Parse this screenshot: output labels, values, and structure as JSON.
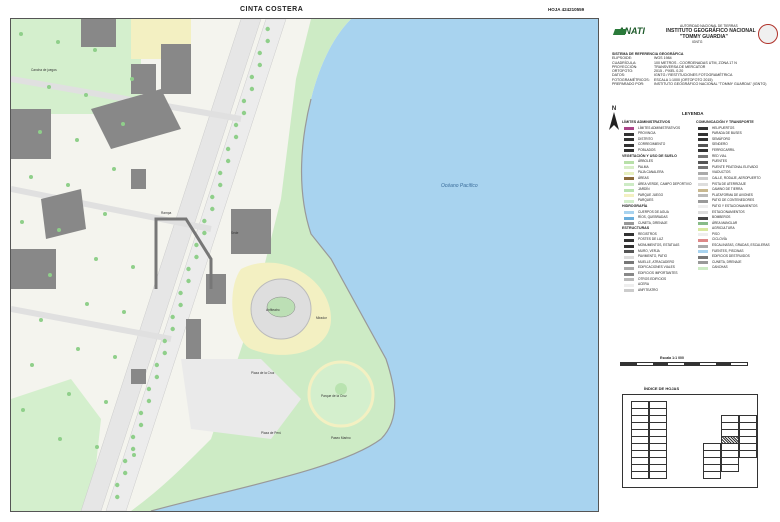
{
  "map": {
    "title": "CINTA COSTERA",
    "sheet_code": "HOJA 424210559",
    "sea_label": "Océano Pacífico",
    "place_labels": [
      "Cancha de juegos",
      "Sede",
      "Anfiteatro",
      "Plaza de la Cruz",
      "Parque de la Cruz",
      "Mirador",
      "Rampa",
      "Plaza de Perú",
      "Paseo Marino"
    ],
    "colors": {
      "sea": "#a8d3ef",
      "park": "#cdebc5",
      "sand": "#f3f0c2",
      "building": "#888888",
      "road": "#e6e6e6",
      "tree": "#8fcf8a"
    }
  },
  "panel": {
    "authority": "AUTORIDAD NACIONAL DE TIERRAS",
    "logo": "ANATI",
    "institute_1": "INSTITUTO GEOGRÁFICO NACIONAL",
    "institute_2": "\"TOMMY GUARDIA\"",
    "acronym": "IGNTG",
    "reference_header": "SISTEMA DE REFERENCIA GEOGRÁFICA",
    "reference_rows": [
      [
        "ELIPSOIDE:",
        "WGS 1984"
      ],
      [
        "CUADRÍCULA:",
        "100 METROS - COORDENADAS UTM, ZONA 17 N"
      ],
      [
        "PROYECCIÓN:",
        "TRANSVERSA DE MERCATOR"
      ],
      [
        "ORTOFOTO:",
        "2015 - PIXEL 0.20"
      ],
      [
        "DATOS:",
        "IGNTG / RESTITUCIONES FOTOGRAMÉTRICA"
      ],
      [
        "FOTOGRAMÉTRICOS:",
        "ESCALA 1:1000 (ORTOFOTO 2015)"
      ],
      [
        "PREPARADO POR:",
        "INSTITUTO GEOGRÁFICO NACIONAL \"TOMMY GUARDIA\" (IGNTG)"
      ]
    ],
    "north": "N",
    "legend_title": "LEYENDA",
    "legend_left": [
      {
        "header": "LÍMITES ADMINISTRATIVOS"
      },
      {
        "label": "LÍMITES ADMINISTRATIVOS",
        "color": "#aa4488"
      },
      {
        "label": "PROVINCIA",
        "color": "#333333"
      },
      {
        "label": "DISTRITO",
        "color": "#333333"
      },
      {
        "label": "CORREGIMIENTO",
        "color": "#333333"
      },
      {
        "label": "POBLADOS",
        "color": "#333333"
      },
      {
        "header": "VEGETACIÓN Y USO DE SUELO"
      },
      {
        "label": "ÁRBOLES",
        "color": "#b8e0a8"
      },
      {
        "label": "PALMA",
        "color": "#d8eec8"
      },
      {
        "label": "PAJA CANALERA",
        "color": "#e8f0c0"
      },
      {
        "label": "ÁREAS",
        "color": "#8a6a3a"
      },
      {
        "label": "ÁREA VERDE, CAMPO DEPORTIVO",
        "color": "#cdebc5"
      },
      {
        "label": "JARDÍN",
        "color": "#b9e3b0"
      },
      {
        "label": "PARQUE JUEGO",
        "color": "#f3f0c2"
      },
      {
        "label": "PARQUES",
        "color": "#d4efcd"
      },
      {
        "header": "HIDROGRAFÍA"
      },
      {
        "label": "CUERPOS DE AGUA",
        "color": "#a8d3ef"
      },
      {
        "label": "RÍOS, QUEBRADAS",
        "color": "#6aaedc"
      },
      {
        "label": "CUNETA, DRENAJE",
        "color": "#999999"
      },
      {
        "header": "ESTRUCTURAS"
      },
      {
        "label": "REGISTROS",
        "color": "#333333"
      },
      {
        "label": "POSTES DE LUZ",
        "color": "#333333"
      },
      {
        "label": "MONUMENTOS, ESTATUAS",
        "color": "#333333"
      },
      {
        "label": "MURO, VERJA",
        "color": "#555555"
      },
      {
        "label": "PAVIMENTO, PATIO",
        "color": "#dddddd"
      },
      {
        "label": "MUELLE, ATRACADERO",
        "color": "#777777"
      },
      {
        "label": "EDIFICACIONES VIALES",
        "color": "#aaaaaa"
      },
      {
        "label": "EDIFICIOS IMPORTANTES",
        "color": "#888888"
      },
      {
        "label": "OTROS EDIFICIOS",
        "color": "#bbbbbb"
      },
      {
        "label": "ACERA",
        "color": "#eeeeee"
      },
      {
        "label": "ANFITEATRO",
        "color": "#cccccc"
      }
    ],
    "legend_right": [
      {
        "header": "COMUNICACIÓN Y TRANSPORTE"
      },
      {
        "label": "HELIPUERTOS",
        "color": "#333333"
      },
      {
        "label": "PARADA DE BUSES",
        "color": "#333333"
      },
      {
        "label": "SEMÁFORO",
        "color": "#333333"
      },
      {
        "label": "SENDERO",
        "color": "#555555"
      },
      {
        "label": "FERROCARRIL",
        "color": "#333333"
      },
      {
        "label": "RED VIAL",
        "color": "#777777"
      },
      {
        "label": "PUENTES",
        "color": "#555555"
      },
      {
        "label": "PUENTE PEATONAL ELEVADO",
        "color": "#777777"
      },
      {
        "label": "VIADUCTOS",
        "color": "#aaaaaa"
      },
      {
        "label": "CALLE, RODAJE, AEROPUERTO",
        "color": "#cccccc"
      },
      {
        "label": "PISTA DE ATERRIZAJE",
        "color": "#dddddd"
      },
      {
        "label": "CAMINO DE TIERRA",
        "color": "#c8b890"
      },
      {
        "label": "PLATAFORMA DE AVIONES",
        "color": "#bbbbbb"
      },
      {
        "label": "PATIO DE CONTENEDORES",
        "color": "#999999"
      },
      {
        "label": "PATIO Y ESTACIONAMIENTOS",
        "color": "#eeeeee"
      },
      {
        "label": "ESTACIONAMIENTOS",
        "color": "#dddddd"
      },
      {
        "header": ""
      },
      {
        "label": "BOMBEROS",
        "color": "#444444"
      },
      {
        "label": "ÁREA MANGLAR",
        "color": "#88bb88"
      },
      {
        "label": "AGRICULTURA",
        "color": "#d8e8a0"
      },
      {
        "label": "PISO",
        "color": "#eeeeee"
      },
      {
        "label": "CICLOVÍA",
        "color": "#dd8888"
      },
      {
        "label": "ESCALINATAS, GRADAS, ESCALERAS",
        "color": "#aaaaaa"
      },
      {
        "label": "FUENTES, PISCINAS",
        "color": "#a8d3ef"
      },
      {
        "label": "EDIFICIOS DESTRUIDOS",
        "color": "#777777"
      },
      {
        "label": "CUNETA, DRENAJE",
        "color": "#999999"
      },
      {
        "label": "CANCHAS",
        "color": "#cdebc5"
      }
    ],
    "scale_label": "Escala 1:1 000",
    "index_title": "ÍNDICE DE HOJAS"
  }
}
